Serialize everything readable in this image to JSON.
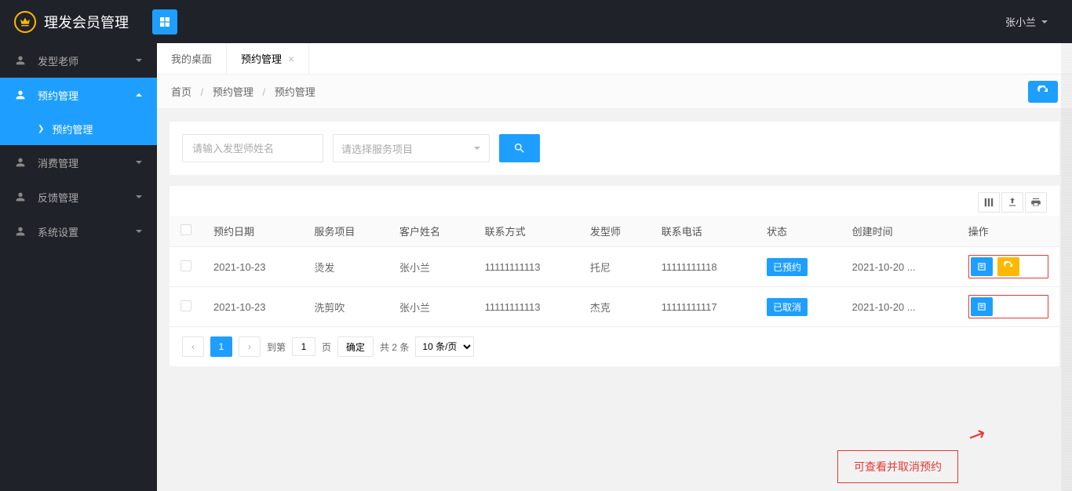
{
  "header": {
    "app_title": "理发会员管理",
    "username": "张小兰"
  },
  "sidebar": {
    "items": [
      {
        "label": "发型老师",
        "expanded": false
      },
      {
        "label": "预约管理",
        "expanded": true
      },
      {
        "label": "消费管理",
        "expanded": false
      },
      {
        "label": "反馈管理",
        "expanded": false
      },
      {
        "label": "系统设置",
        "expanded": false
      }
    ],
    "sub_item": "预约管理"
  },
  "tabs": [
    {
      "label": "我的桌面",
      "closable": false
    },
    {
      "label": "预约管理",
      "closable": true
    }
  ],
  "breadcrumb": [
    "首页",
    "预约管理",
    "预约管理"
  ],
  "search": {
    "name_placeholder": "请输入发型师姓名",
    "service_placeholder": "请选择服务项目"
  },
  "table": {
    "columns": [
      "预约日期",
      "服务项目",
      "客户姓名",
      "联系方式",
      "发型师",
      "联系电话",
      "状态",
      "创建时间",
      "操作"
    ],
    "rows": [
      {
        "date": "2021-10-23",
        "service": "烫发",
        "customer": "张小兰",
        "contact": "11111111113",
        "stylist": "托尼",
        "phone": "11111111118",
        "status": "已预约",
        "created": "2021-10-20 ...",
        "has_cancel": true
      },
      {
        "date": "2021-10-23",
        "service": "洗剪吹",
        "customer": "张小兰",
        "contact": "11111111113",
        "stylist": "杰克",
        "phone": "11111111117",
        "status": "已取消",
        "created": "2021-10-20 ...",
        "has_cancel": false
      }
    ]
  },
  "pager": {
    "current": "1",
    "goto_label_prefix": "到第",
    "goto_value": "1",
    "goto_label_suffix": "页",
    "confirm": "确定",
    "total": "共 2 条",
    "per_page": "10 条/页"
  },
  "callout": "可查看并取消预约"
}
